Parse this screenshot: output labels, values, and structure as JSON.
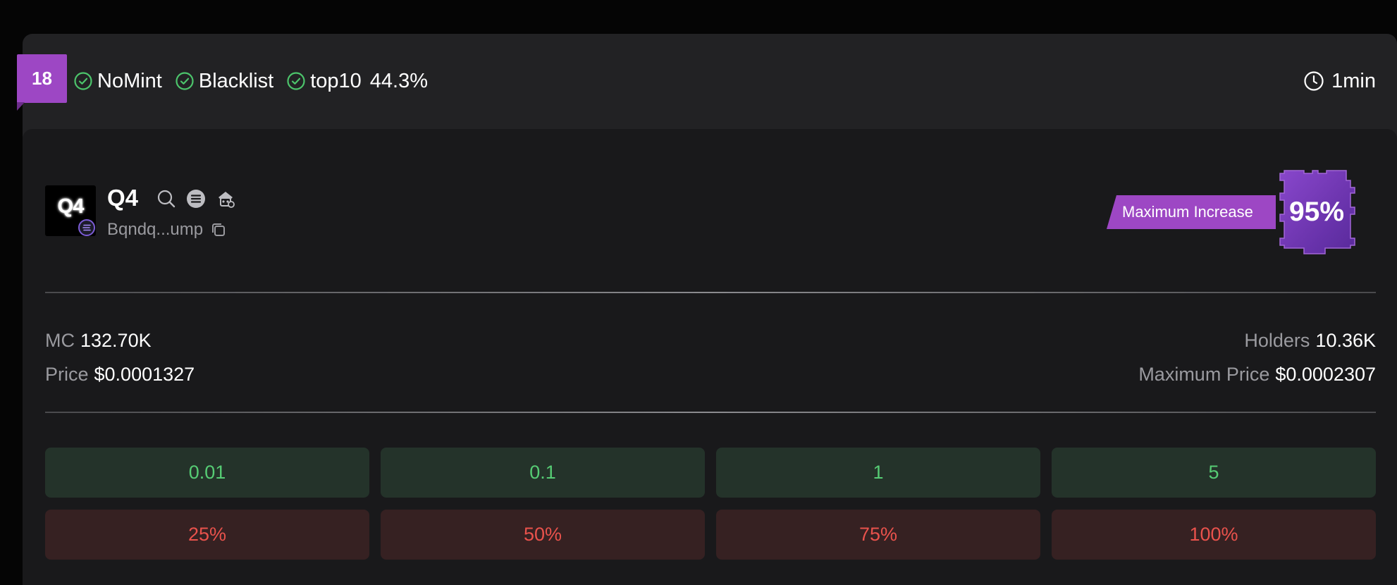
{
  "header": {
    "rank": "18",
    "tags": [
      {
        "label": "NoMint",
        "icon": "check-circle-icon"
      },
      {
        "label": "Blacklist",
        "icon": "check-circle-icon"
      },
      {
        "label": "top10",
        "value": "44.3%",
        "icon": "check-circle-icon"
      }
    ],
    "age": "1min",
    "age_icon": "clock-icon"
  },
  "token": {
    "logo_text": "Q4",
    "symbol": "Q4",
    "address": "Bqndq...ump",
    "icons": [
      "search-icon",
      "menu-icon",
      "wizard-icon"
    ],
    "copy_icon": "copy-icon"
  },
  "max_increase": {
    "label": "Maximum Increase",
    "value": "95%"
  },
  "stats": {
    "mc_label": "MC",
    "mc_value": "132.70K",
    "price_label": "Price",
    "price_value": "$0.0001327",
    "holders_label": "Holders",
    "holders_value": "10.36K",
    "max_price_label": "Maximum Price",
    "max_price_value": "$0.0002307"
  },
  "buy_buttons": [
    "0.01",
    "0.1",
    "1",
    "5"
  ],
  "sell_buttons": [
    "25%",
    "50%",
    "75%",
    "100%"
  ],
  "colors": {
    "accent_purple": "#9d47c4",
    "buy_green": "#56cc74",
    "sell_red": "#e9524c",
    "check_green": "#4cc46b"
  }
}
